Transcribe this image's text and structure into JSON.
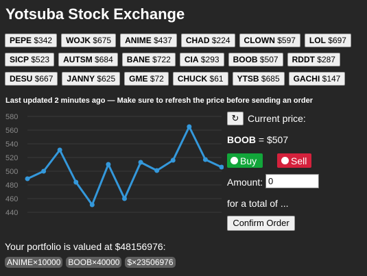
{
  "title": "Yotsuba Stock Exchange",
  "tickers": [
    [
      {
        "symbol": "PEPE",
        "price": "$342"
      },
      {
        "symbol": "WOJK",
        "price": "$675"
      },
      {
        "symbol": "ANIME",
        "price": "$437"
      },
      {
        "symbol": "CHAD",
        "price": "$224"
      },
      {
        "symbol": "CLOWN",
        "price": "$597"
      },
      {
        "symbol": "LOL",
        "price": "$697"
      }
    ],
    [
      {
        "symbol": "SICP",
        "price": "$523"
      },
      {
        "symbol": "AUTSM",
        "price": "$684"
      },
      {
        "symbol": "BANE",
        "price": "$722"
      },
      {
        "symbol": "CIA",
        "price": "$293"
      },
      {
        "symbol": "BOOB",
        "price": "$507"
      },
      {
        "symbol": "RDDT",
        "price": "$287"
      }
    ],
    [
      {
        "symbol": "DESU",
        "price": "$667"
      },
      {
        "symbol": "JANNY",
        "price": "$625"
      },
      {
        "symbol": "GME",
        "price": "$72"
      },
      {
        "symbol": "CHUCK",
        "price": "$61"
      },
      {
        "symbol": "YTSB",
        "price": "$685"
      },
      {
        "symbol": "GACHI",
        "price": "$147"
      }
    ]
  ],
  "status": {
    "updated_text": "Last updated 2 minutes ago — Make sure to refresh the price before sending an order"
  },
  "chart_data": {
    "type": "line",
    "x": [
      1,
      2,
      3,
      4,
      5,
      6,
      7,
      8,
      9,
      10,
      11,
      12,
      13
    ],
    "values": [
      489,
      500,
      531,
      484,
      451,
      510,
      460,
      513,
      501,
      516,
      565,
      517,
      506
    ],
    "ylim": [
      440,
      580
    ],
    "yticks": [
      440,
      460,
      480,
      500,
      520,
      540,
      560,
      580
    ],
    "grid": true,
    "line_color": "#3498db"
  },
  "order": {
    "refresh_icon": "refresh-icon",
    "current_price_label": "Current price:",
    "symbol": "BOOB",
    "price_text": " = $507",
    "buy_label": "Buy",
    "sell_label": "Sell",
    "amount_label": "Amount:",
    "amount_value": "0",
    "total_text": "for a total of ...",
    "confirm_label": "Confirm Order"
  },
  "portfolio": {
    "value_text": "Your portfolio is valued at $48156976:",
    "holdings": [
      "ANIME×10000",
      "BOOB×40000",
      "$×23506976"
    ]
  },
  "colors": {
    "background": "#262626",
    "buy": "#12a63a",
    "sell": "#d4213c",
    "chip": "#5f5f5f"
  }
}
